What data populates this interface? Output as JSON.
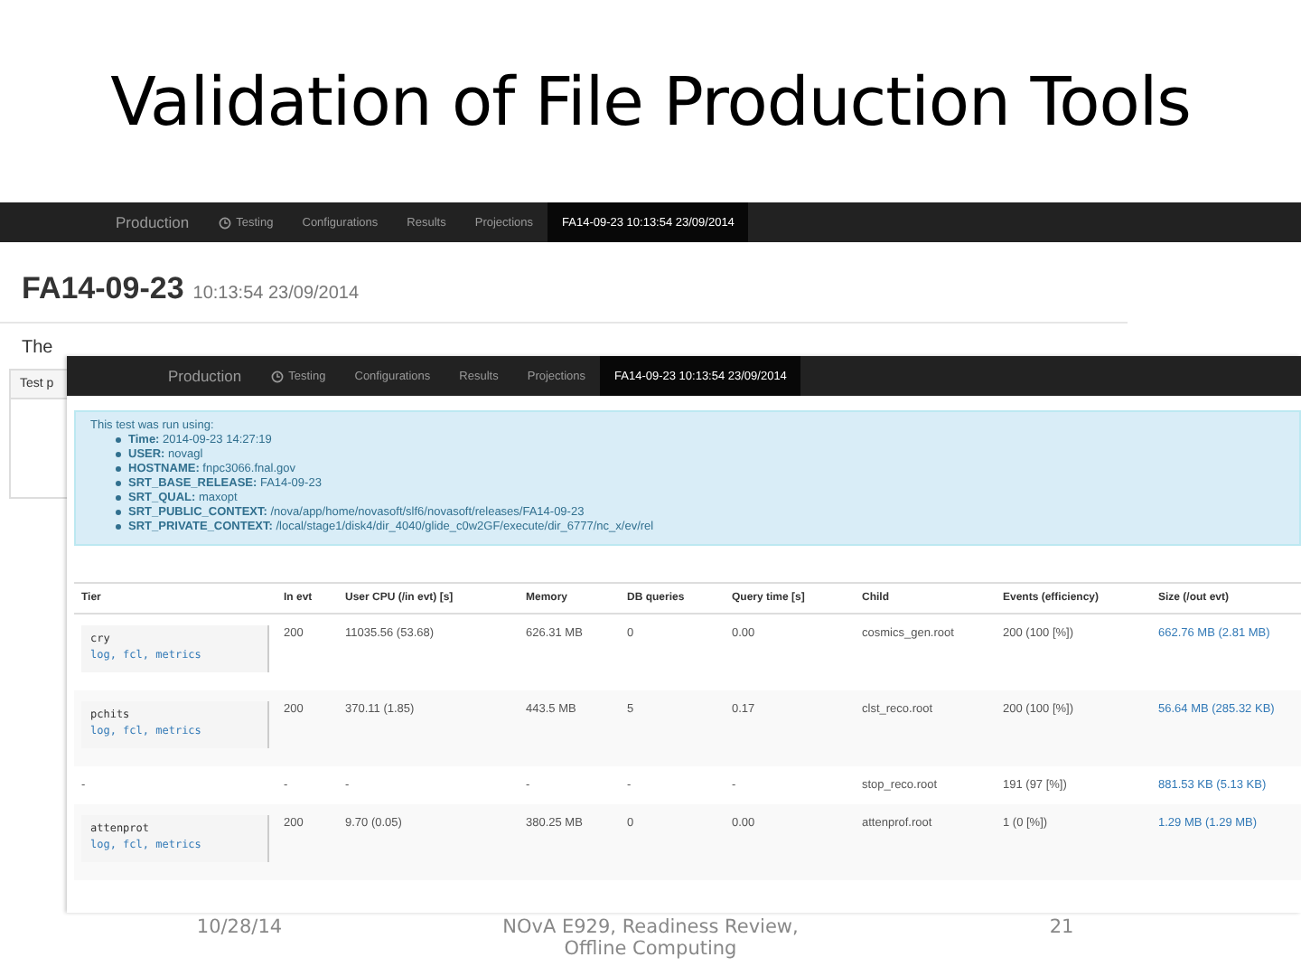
{
  "slide": {
    "title": "Validation of File Production Tools",
    "date": "10/28/14",
    "footer": "NOvA E929, Readiness Review, Offline Computing",
    "page": "21"
  },
  "back_screen": {
    "nav": [
      {
        "label": "Production",
        "kind": "brand",
        "selected": false
      },
      {
        "label": "Testing",
        "kind": "clock",
        "selected": false
      },
      {
        "label": "Configurations",
        "kind": "link",
        "selected": false
      },
      {
        "label": "Results",
        "kind": "link",
        "selected": false
      },
      {
        "label": "Projections",
        "kind": "link",
        "selected": false
      },
      {
        "label": "FA14-09-23 10:13:54 23/09/2014",
        "kind": "link",
        "selected": true
      }
    ],
    "heading": "FA14-09-23",
    "subheading": "10:13:54 23/09/2014",
    "intro": "The",
    "panel_title": "Test p"
  },
  "front_screen": {
    "nav": [
      {
        "label": "Production",
        "kind": "brand",
        "selected": false
      },
      {
        "label": "Testing",
        "kind": "clock",
        "selected": false
      },
      {
        "label": "Configurations",
        "kind": "link",
        "selected": false
      },
      {
        "label": "Results",
        "kind": "link",
        "selected": false
      },
      {
        "label": "Projections",
        "kind": "link",
        "selected": false
      },
      {
        "label": "FA14-09-23 10:13:54 23/09/2014",
        "kind": "link",
        "selected": true
      }
    ],
    "info": {
      "intro": "This test was run using:",
      "items": [
        {
          "key": "Time:",
          "value": "2014-09-23 14:27:19"
        },
        {
          "key": "USER:",
          "value": "novagl"
        },
        {
          "key": "HOSTNAME:",
          "value": "fnpc3066.fnal.gov"
        },
        {
          "key": "SRT_BASE_RELEASE:",
          "value": "FA14-09-23"
        },
        {
          "key": "SRT_QUAL:",
          "value": "maxopt"
        },
        {
          "key": "SRT_PUBLIC_CONTEXT:",
          "value": "/nova/app/home/novasoft/slf6/novasoft/releases/FA14-09-23"
        },
        {
          "key": "SRT_PRIVATE_CONTEXT:",
          "value": "/local/stage1/disk4/dir_4040/glide_c0w2GF/execute/dir_6777/nc_x/ev/rel"
        }
      ]
    },
    "table": {
      "columns": [
        "Tier",
        "In evt",
        "User CPU (/in evt) [s]",
        "Memory",
        "DB queries",
        "Query time [s]",
        "Child",
        "Events (efficiency)",
        "Size (/out evt)"
      ],
      "rows": [
        {
          "kind": "tier",
          "links": "log, fcl, metrics",
          "cells": [
            "cry",
            "200",
            "11035.56 (53.68)",
            "626.31 MB",
            "0",
            "0.00",
            "cosmics_gen.root",
            "200 (100 [%])",
            "662.76 MB (2.81 MB)"
          ]
        },
        {
          "kind": "tier",
          "links": "log, fcl, metrics",
          "cells": [
            "pchits",
            "200",
            "370.11 (1.85)",
            "443.5 MB",
            "5",
            "0.17",
            "clst_reco.root",
            "200 (100 [%])",
            "56.64 MB (285.32 KB)"
          ]
        },
        {
          "kind": "plain",
          "cells": [
            "-",
            "-",
            "-",
            "-",
            "-",
            "-",
            "stop_reco.root",
            "191 (97 [%])",
            "881.53 KB (5.13 KB)"
          ]
        },
        {
          "kind": "tier",
          "links": "log, fcl, metrics",
          "cells": [
            "attenprot",
            "200",
            "9.70 (0.05)",
            "380.25 MB",
            "0",
            "0.00",
            "attenprof.root",
            "1 (0 [%])",
            "1.29 MB (1.29 MB)"
          ]
        }
      ]
    }
  }
}
